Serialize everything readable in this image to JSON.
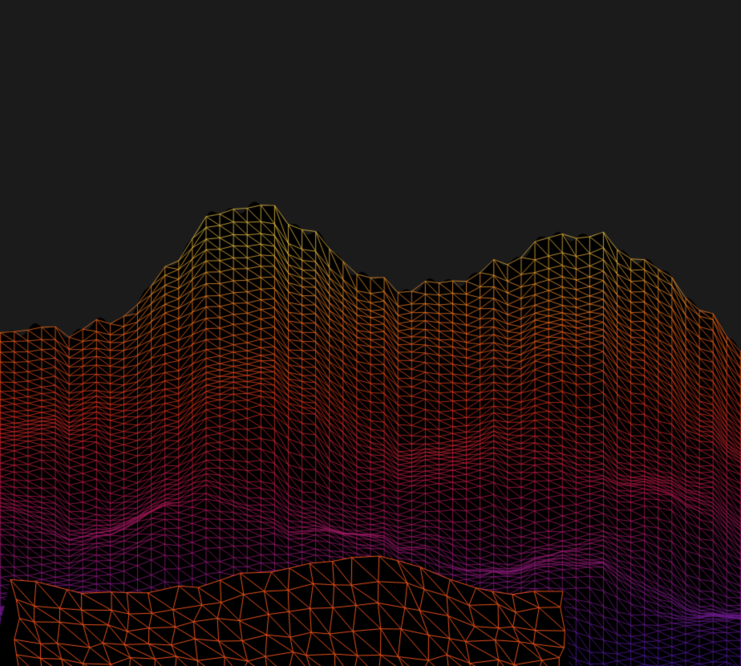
{
  "scene": {
    "kind": "wireframe-terrain",
    "background_color": "#1b1b1b",
    "frame_border_color": "#3a78c8",
    "fill_color": "#000000",
    "palette": [
      "#4a1a9a",
      "#8a1a7a",
      "#b0184a",
      "#d8301c",
      "#f06a1c",
      "#e8c040"
    ],
    "foreground_ridge_color": "#e8501c"
  }
}
